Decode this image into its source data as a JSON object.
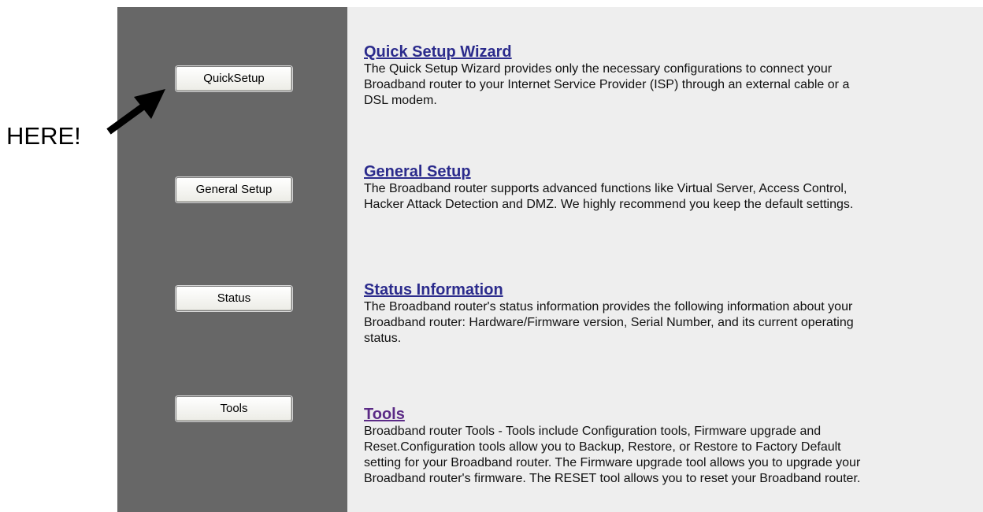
{
  "annotation": {
    "label": "HERE!"
  },
  "sidebar": {
    "buttons": [
      {
        "label": "QuickSetup"
      },
      {
        "label": "General Setup"
      },
      {
        "label": "Status"
      },
      {
        "label": "Tools"
      }
    ]
  },
  "sections": [
    {
      "title": "Quick Setup Wizard",
      "description": "The Quick Setup Wizard provides only the necessary configurations to connect your Broadband router to your Internet Service Provider (ISP) through an external cable or a DSL modem."
    },
    {
      "title": "General Setup",
      "description": "The Broadband router supports advanced functions like Virtual Server, Access Control, Hacker Attack Detection and DMZ. We highly recommend you keep the default settings."
    },
    {
      "title": "Status Information",
      "description": "The Broadband router's status information provides the following information about your Broadband router: Hardware/Firmware version, Serial Number, and its current operating status."
    },
    {
      "title": "Tools",
      "description": "Broadband router Tools - Tools include Configuration tools, Firmware upgrade and Reset.Configuration tools allow you to Backup, Restore, or Restore to Factory Default setting for your Broadband router. The Firmware upgrade tool allows you to upgrade your Broadband router's firmware. The RESET tool allows you to reset your Broadband router."
    }
  ],
  "colors": {
    "sidebar_bg": "#676767",
    "content_bg": "#eeeeee",
    "link": "#2b2b8c",
    "visited_link": "#5b2a86"
  }
}
